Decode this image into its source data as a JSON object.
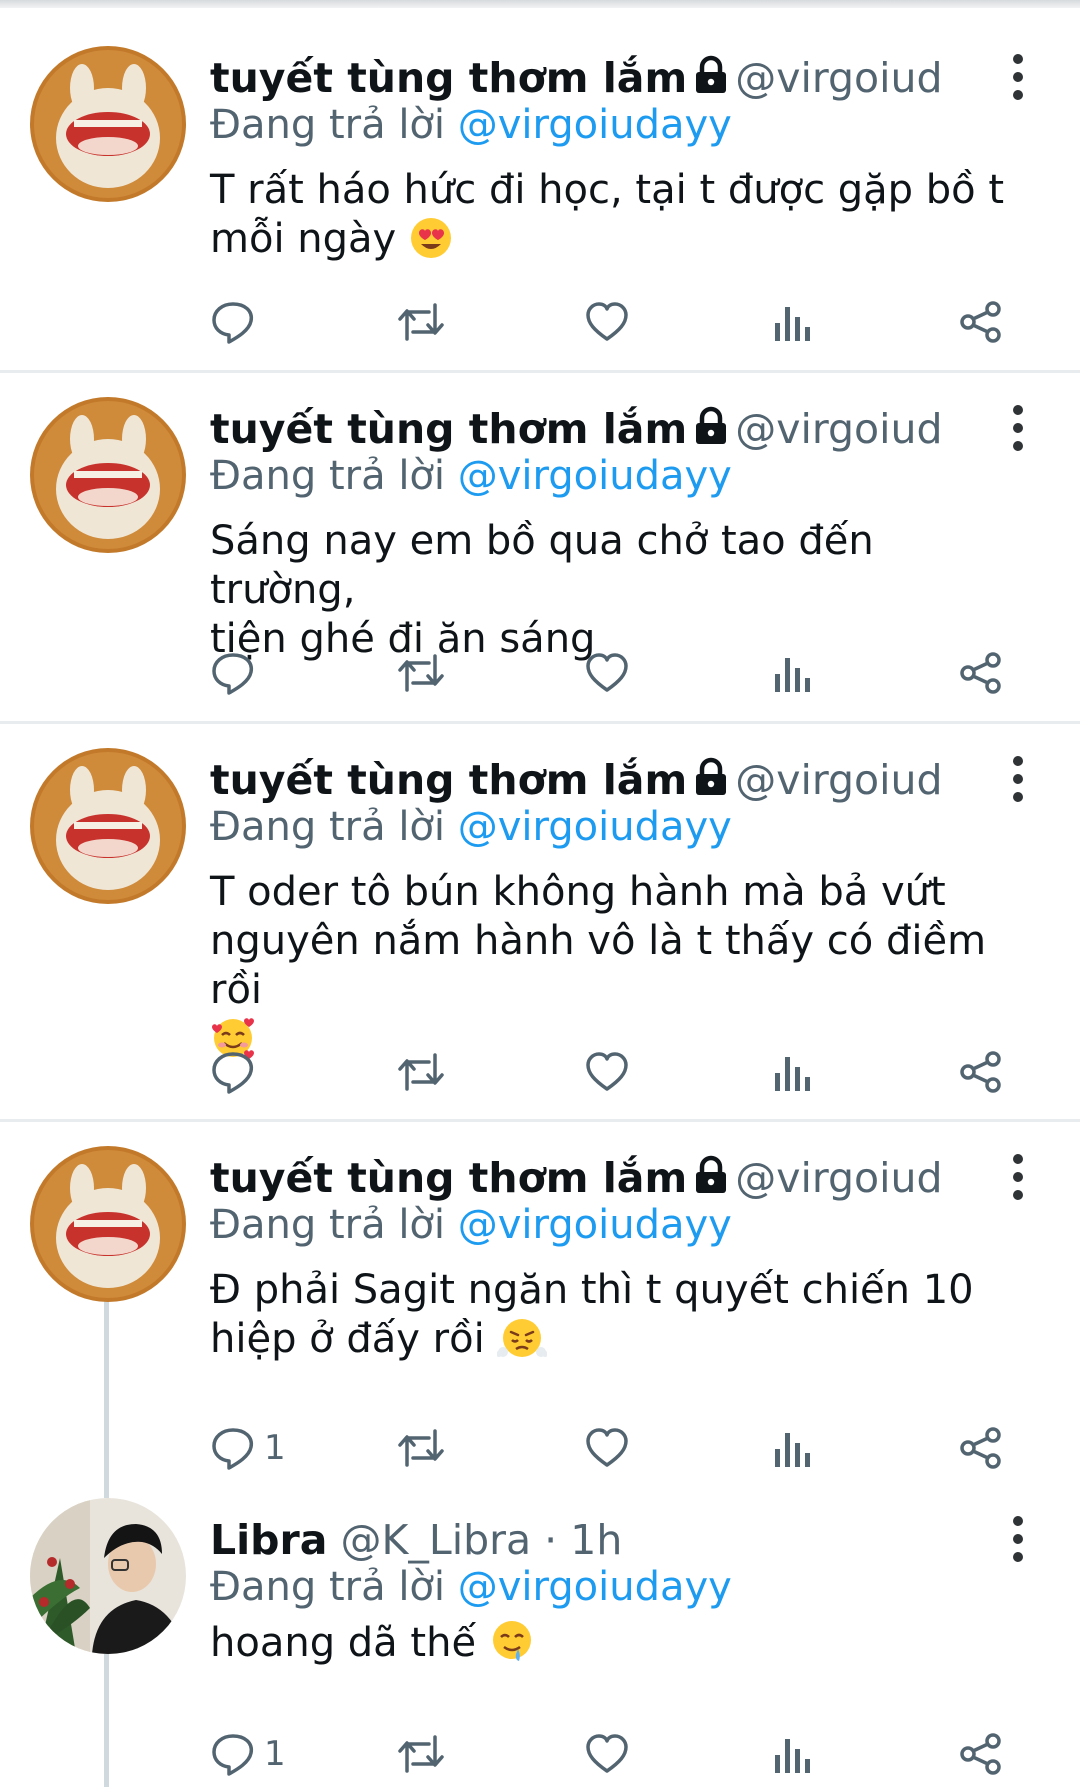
{
  "reply_prefix": "Đang trả lời",
  "tweets": [
    {
      "name": "tuyết tùng thơm lắm",
      "handle": "@virgoiuda···",
      "reply_mention": "@virgoiudayy",
      "text_lines": [
        "T rất háo hức đi học, tại t được gặp bồ t",
        "mỗi ngày"
      ],
      "emoji": "smiling-face-with-heart-eyes",
      "reply_count": ""
    },
    {
      "name": "tuyết tùng thơm lắm",
      "handle": "@virgoiuda···",
      "reply_mention": "@virgoiudayy",
      "text_lines": [
        "Sáng nay em bồ qua chở tao đến trường,",
        "tiện ghé đi ăn sáng"
      ],
      "reply_count": ""
    },
    {
      "name": "tuyết tùng thơm lắm",
      "handle": "@virgoiuda···",
      "reply_mention": "@virgoiudayy",
      "text_lines": [
        "T oder tô bún không hành mà bả vứt",
        "nguyên nắm hành vô là t thấy có điềm rồi"
      ],
      "emoji": "smiling-face-with-hearts",
      "reply_count": ""
    },
    {
      "name": "tuyết tùng thơm lắm",
      "handle": "@virgoiuda···",
      "reply_mention": "@virgoiudayy",
      "text_lines": [
        "Đ phải Sagit ngăn thì t quyết chiến 10",
        "hiệp ở đấy rồi"
      ],
      "emoji": "face-with-steam-from-nose",
      "reply_count": "1"
    },
    {
      "name": "Libra",
      "handle": "@K_Libra",
      "time": "1h",
      "reply_mention": "@virgoiudayy",
      "text_lines": [
        "hoang dã thế"
      ],
      "emoji": "drooling-face",
      "reply_count": "1"
    }
  ],
  "separator": "·",
  "colors": {
    "link": "#1d9bf0",
    "secondary": "#536471",
    "text": "#0f1419",
    "divider": "#e9ecee"
  }
}
